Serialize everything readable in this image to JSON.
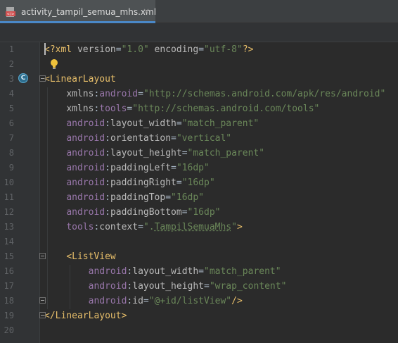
{
  "tab": {
    "filename": "activity_tampil_semua_mhs.xml",
    "close": "×",
    "file_icon": "xml-file-icon"
  },
  "gutter_icons": {
    "line3": "C",
    "line2": "lightbulb-icon"
  },
  "lines": [
    {
      "n": "1",
      "segs": [
        [
          "punct",
          "<?"
        ],
        [
          "tag",
          "xml "
        ],
        [
          "attr",
          "version"
        ],
        [
          "plain",
          "="
        ],
        [
          "val",
          "\"1.0\""
        ],
        [
          "attr",
          " encoding"
        ],
        [
          "plain",
          "="
        ],
        [
          "val",
          "\"utf-8\""
        ],
        [
          "punct",
          "?>"
        ]
      ]
    },
    {
      "n": "2",
      "segs": []
    },
    {
      "n": "3",
      "segs": [
        [
          "punct",
          "<"
        ],
        [
          "tag",
          "LinearLayout"
        ]
      ]
    },
    {
      "n": "4",
      "segs": [
        [
          "plain",
          "    "
        ],
        [
          "attr",
          "xmlns"
        ],
        [
          "plain",
          ":"
        ],
        [
          "ns",
          "android"
        ],
        [
          "plain",
          "="
        ],
        [
          "val",
          "\"http://schemas.android.com/apk/res/android\""
        ]
      ]
    },
    {
      "n": "5",
      "segs": [
        [
          "plain",
          "    "
        ],
        [
          "attr",
          "xmlns"
        ],
        [
          "plain",
          ":"
        ],
        [
          "ns",
          "tools"
        ],
        [
          "plain",
          "="
        ],
        [
          "val",
          "\"http://schemas.android.com/tools\""
        ]
      ]
    },
    {
      "n": "6",
      "segs": [
        [
          "plain",
          "    "
        ],
        [
          "ns",
          "android"
        ],
        [
          "plain",
          ":"
        ],
        [
          "attr",
          "layout_width"
        ],
        [
          "plain",
          "="
        ],
        [
          "val",
          "\"match_parent\""
        ]
      ]
    },
    {
      "n": "7",
      "segs": [
        [
          "plain",
          "    "
        ],
        [
          "ns",
          "android"
        ],
        [
          "plain",
          ":"
        ],
        [
          "attr",
          "orientation"
        ],
        [
          "plain",
          "="
        ],
        [
          "val",
          "\"vertical\""
        ]
      ]
    },
    {
      "n": "8",
      "segs": [
        [
          "plain",
          "    "
        ],
        [
          "ns",
          "android"
        ],
        [
          "plain",
          ":"
        ],
        [
          "attr",
          "layout_height"
        ],
        [
          "plain",
          "="
        ],
        [
          "val",
          "\"match_parent\""
        ]
      ]
    },
    {
      "n": "9",
      "segs": [
        [
          "plain",
          "    "
        ],
        [
          "ns",
          "android"
        ],
        [
          "plain",
          ":"
        ],
        [
          "attr",
          "paddingLeft"
        ],
        [
          "plain",
          "="
        ],
        [
          "val",
          "\"16dp\""
        ]
      ]
    },
    {
      "n": "10",
      "segs": [
        [
          "plain",
          "    "
        ],
        [
          "ns",
          "android"
        ],
        [
          "plain",
          ":"
        ],
        [
          "attr",
          "paddingRight"
        ],
        [
          "plain",
          "="
        ],
        [
          "val",
          "\"16dp\""
        ]
      ]
    },
    {
      "n": "11",
      "segs": [
        [
          "plain",
          "    "
        ],
        [
          "ns",
          "android"
        ],
        [
          "plain",
          ":"
        ],
        [
          "attr",
          "paddingTop"
        ],
        [
          "plain",
          "="
        ],
        [
          "val",
          "\"16dp\""
        ]
      ]
    },
    {
      "n": "12",
      "segs": [
        [
          "plain",
          "    "
        ],
        [
          "ns",
          "android"
        ],
        [
          "plain",
          ":"
        ],
        [
          "attr",
          "paddingBottom"
        ],
        [
          "plain",
          "="
        ],
        [
          "val",
          "\"16dp\""
        ]
      ]
    },
    {
      "n": "13",
      "segs": [
        [
          "plain",
          "    "
        ],
        [
          "ns",
          "tools"
        ],
        [
          "plain",
          ":"
        ],
        [
          "attr",
          "context"
        ],
        [
          "plain",
          "="
        ],
        [
          "val",
          "\"."
        ],
        [
          "valref",
          "TampilSemuaMhs"
        ],
        [
          "val",
          "\""
        ],
        [
          "punct",
          ">"
        ]
      ]
    },
    {
      "n": "14",
      "segs": []
    },
    {
      "n": "15",
      "segs": [
        [
          "plain",
          "    "
        ],
        [
          "punct",
          "<"
        ],
        [
          "tag",
          "ListView"
        ]
      ]
    },
    {
      "n": "16",
      "segs": [
        [
          "plain",
          "        "
        ],
        [
          "ns",
          "android"
        ],
        [
          "plain",
          ":"
        ],
        [
          "attr",
          "layout_width"
        ],
        [
          "plain",
          "="
        ],
        [
          "val",
          "\"match_parent\""
        ]
      ]
    },
    {
      "n": "17",
      "segs": [
        [
          "plain",
          "        "
        ],
        [
          "ns",
          "android"
        ],
        [
          "plain",
          ":"
        ],
        [
          "attr",
          "layout_height"
        ],
        [
          "plain",
          "="
        ],
        [
          "val",
          "\"wrap_content\""
        ]
      ]
    },
    {
      "n": "18",
      "segs": [
        [
          "plain",
          "        "
        ],
        [
          "ns",
          "android"
        ],
        [
          "plain",
          ":"
        ],
        [
          "attr",
          "id"
        ],
        [
          "plain",
          "="
        ],
        [
          "val",
          "\"@+id/listView\""
        ],
        [
          "punct",
          "/>"
        ]
      ]
    },
    {
      "n": "19",
      "segs": [
        [
          "punct",
          "</"
        ],
        [
          "tag",
          "LinearLayout"
        ],
        [
          "punct",
          ">"
        ]
      ]
    },
    {
      "n": "20",
      "segs": []
    }
  ]
}
